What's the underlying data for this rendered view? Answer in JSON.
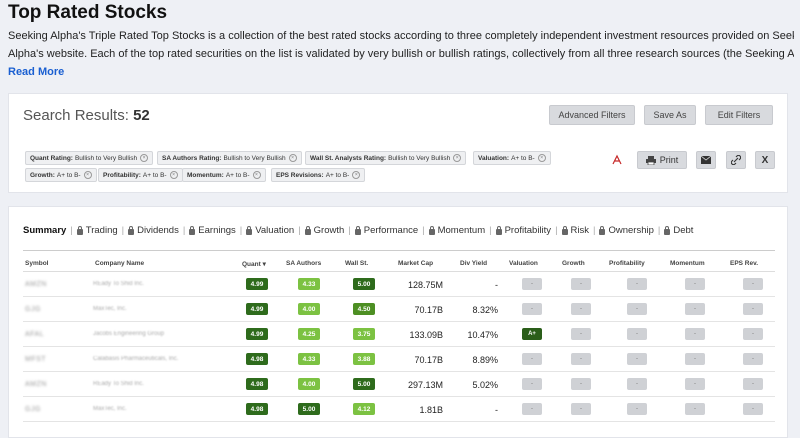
{
  "page": {
    "title": "Top Rated Stocks",
    "intro_line1": "Seeking Alpha's Triple Rated Top Stocks is a collection of the best rated stocks according to three completely independent investment resources provided on Seeking",
    "intro_line2": "Alpha's website. Each of the top rated securities on the list is validated by very bullish or bullish ratings, collectively from all three research sources (the Seeking Alpha Qua...",
    "read_more": "Read More"
  },
  "search": {
    "label": "Search Results:",
    "count": "52",
    "buttons": {
      "advanced": "Advanced Filters",
      "save_as": "Save As",
      "edit": "Edit Filters"
    }
  },
  "filters": [
    {
      "key": "Quant Rating:",
      "value": "Bullish to Very Bullish"
    },
    {
      "key": "SA Authors Rating:",
      "value": "Bullish to Very Bullish"
    },
    {
      "key": "Wall St. Analysts Rating:",
      "value": "Bullish to Very Bullish"
    },
    {
      "key": "Valuation:",
      "value": "A+ to B-"
    },
    {
      "key": "Growth:",
      "value": "A+ to B-"
    },
    {
      "key": "Profitability:",
      "value": "A+ to B-"
    },
    {
      "key": "Momentum:",
      "value": "A+ to B-"
    },
    {
      "key": "EPS Revisions:",
      "value": "A+ to B-"
    }
  ],
  "tools": {
    "print": "Print",
    "x": "X"
  },
  "tabs": [
    "Summary",
    "Trading",
    "Dividends",
    "Earnings",
    "Valuation",
    "Growth",
    "Performance",
    "Momentum",
    "Profitability",
    "Risk",
    "Ownership",
    "Debt"
  ],
  "columns": {
    "symbol": "Symbol",
    "company": "Company Name",
    "quant": "Quant",
    "sa_authors": "SA Authors",
    "wall_st": "Wall St.",
    "market_cap": "Market Cap",
    "div_yield": "Div Yield",
    "valuation": "Valuation",
    "growth": "Growth",
    "profitability": "Profitability",
    "momentum": "Momentum",
    "eps_rev": "EPS Rev.",
    "sort_indicator": "▾"
  },
  "rows": [
    {
      "symbol": "AMZN",
      "company": "REady To Shid Inc.",
      "quant": "4.99",
      "sa": "4.33",
      "wall": "5.00",
      "cap": "128.75M",
      "div": "-",
      "valuation": "-",
      "growth": "-",
      "profitability": "-",
      "momentum": "-",
      "eps": "-"
    },
    {
      "symbol": "GJG",
      "company": "MaxTec, Inc.",
      "quant": "4.99",
      "sa": "4.00",
      "wall": "4.50",
      "cap": "70.17B",
      "div": "8.32%",
      "valuation": "-",
      "growth": "-",
      "profitability": "-",
      "momentum": "-",
      "eps": "-"
    },
    {
      "symbol": "AFAL",
      "company": "Jacobs Engineering Group",
      "quant": "4.99",
      "sa": "4.25",
      "wall": "3.75",
      "cap": "133.09B",
      "div": "10.47%",
      "valuation": "A+",
      "growth": "-",
      "profitability": "-",
      "momentum": "-",
      "eps": "-"
    },
    {
      "symbol": "MFST",
      "company": "Calabasis Pharmaceuticals, Inc.",
      "quant": "4.98",
      "sa": "4.33",
      "wall": "3.88",
      "cap": "70.17B",
      "div": "8.89%",
      "valuation": "-",
      "growth": "-",
      "profitability": "-",
      "momentum": "-",
      "eps": "-"
    },
    {
      "symbol": "AMZN",
      "company": "REady To Shid Inc.",
      "quant": "4.98",
      "sa": "4.00",
      "wall": "5.00",
      "cap": "297.13M",
      "div": "5.02%",
      "valuation": "-",
      "growth": "-",
      "profitability": "-",
      "momentum": "-",
      "eps": "-"
    },
    {
      "symbol": "GJG",
      "company": "MaxTec, Inc.",
      "quant": "4.98",
      "sa": "5.00",
      "wall": "4.12",
      "cap": "1.81B",
      "div": "-",
      "valuation": "-",
      "growth": "-",
      "profitability": "-",
      "momentum": "-",
      "eps": "-"
    }
  ],
  "colors": {
    "dark_green": "#2e6b1c",
    "mid_green": "#4d8f23",
    "light_green": "#7cc242",
    "link": "#1a5fd1"
  }
}
